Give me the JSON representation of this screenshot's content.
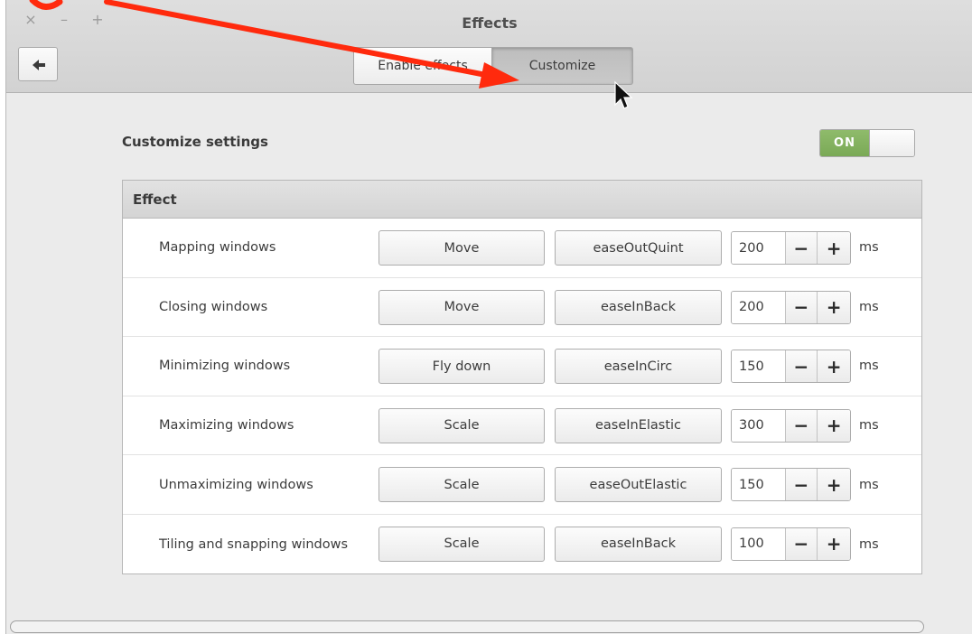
{
  "window": {
    "title": "Effects",
    "controls": {
      "close": "×",
      "minimize": "–",
      "maximize": "+"
    }
  },
  "header": {
    "back_icon": "arrow-left-icon",
    "tabs": [
      {
        "label": "Enable effects",
        "active": false
      },
      {
        "label": "Customize",
        "active": true
      }
    ]
  },
  "customize": {
    "label": "Customize settings",
    "switch_label": "ON",
    "enabled": true
  },
  "effects": {
    "header": "Effect",
    "unit": "ms",
    "rows": [
      {
        "label": "Mapping windows",
        "animation": "Move",
        "easing": "easeOutQuint",
        "duration": "200"
      },
      {
        "label": "Closing windows",
        "animation": "Move",
        "easing": "easeInBack",
        "duration": "200"
      },
      {
        "label": "Minimizing windows",
        "animation": "Fly down",
        "easing": "easeInCirc",
        "duration": "150"
      },
      {
        "label": "Maximizing windows",
        "animation": "Scale",
        "easing": "easeInElastic",
        "duration": "300"
      },
      {
        "label": "Unmaximizing windows",
        "animation": "Scale",
        "easing": "easeOutElastic",
        "duration": "150"
      },
      {
        "label": "Tiling and snapping windows",
        "animation": "Scale",
        "easing": "easeInBack",
        "duration": "100"
      }
    ],
    "minus_glyph": "−",
    "plus_glyph": "+"
  },
  "colors": {
    "switch_on": "#7aa956",
    "annotation_arrow": "#ff2a0d"
  }
}
